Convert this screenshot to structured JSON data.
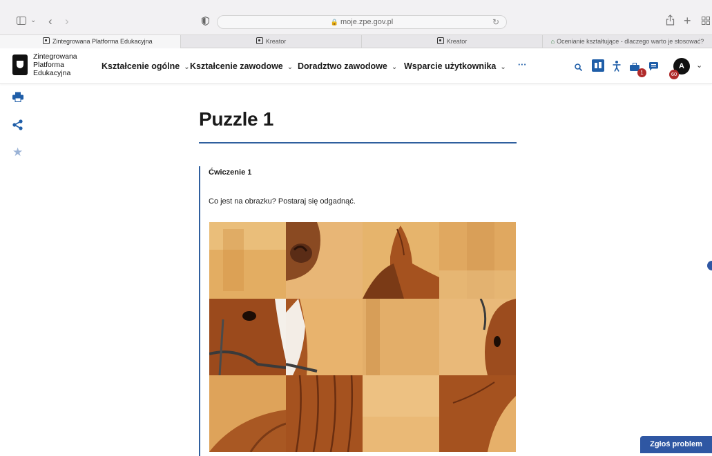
{
  "browser": {
    "url": "moje.zpe.gov.pl",
    "tabs": [
      {
        "label": "Zintegrowana Platforma Edukacyjna",
        "active": true
      },
      {
        "label": "Kreator"
      },
      {
        "label": "Kreator"
      },
      {
        "label": "Ocenianie kształtujące - dlaczego warto je stosować?"
      }
    ]
  },
  "nav": {
    "logo_text": [
      "Zintegrowana",
      "Platforma",
      "Edukacyjna"
    ],
    "items": [
      {
        "label": "Kształcenie ogólne"
      },
      {
        "label": "Kształcenie zawodowe"
      },
      {
        "label": "Doradztwo zawodowe"
      },
      {
        "label": "Wsparcie użytkownika"
      }
    ],
    "more": "···",
    "badge_briefcase": "1",
    "badge_avatar": "60",
    "avatar_letter": "A"
  },
  "page": {
    "title": "Puzzle 1",
    "exercise_title": "Ćwiczenie 1",
    "question": "Co jest na obrazku? Postaraj się odgadnąć."
  },
  "report_button": "Zgłoś problem",
  "colors": {
    "accent": "#2f5f9e",
    "report": "#2f57a3",
    "badge": "#b02a2a",
    "horse": "#a0501e",
    "bg_warm": "#e9b86a"
  },
  "icons": [
    "sidebar-icon",
    "chevron-left-icon",
    "chevron-right-icon",
    "shield-icon",
    "lock-icon",
    "reload-icon",
    "share-icon",
    "plus-icon",
    "grid-icon",
    "search-icon",
    "sign-language-icon",
    "accessibility-icon",
    "briefcase-icon",
    "message-icon",
    "chevron-down-icon",
    "printer-icon",
    "share-nodes-icon",
    "star-icon"
  ]
}
